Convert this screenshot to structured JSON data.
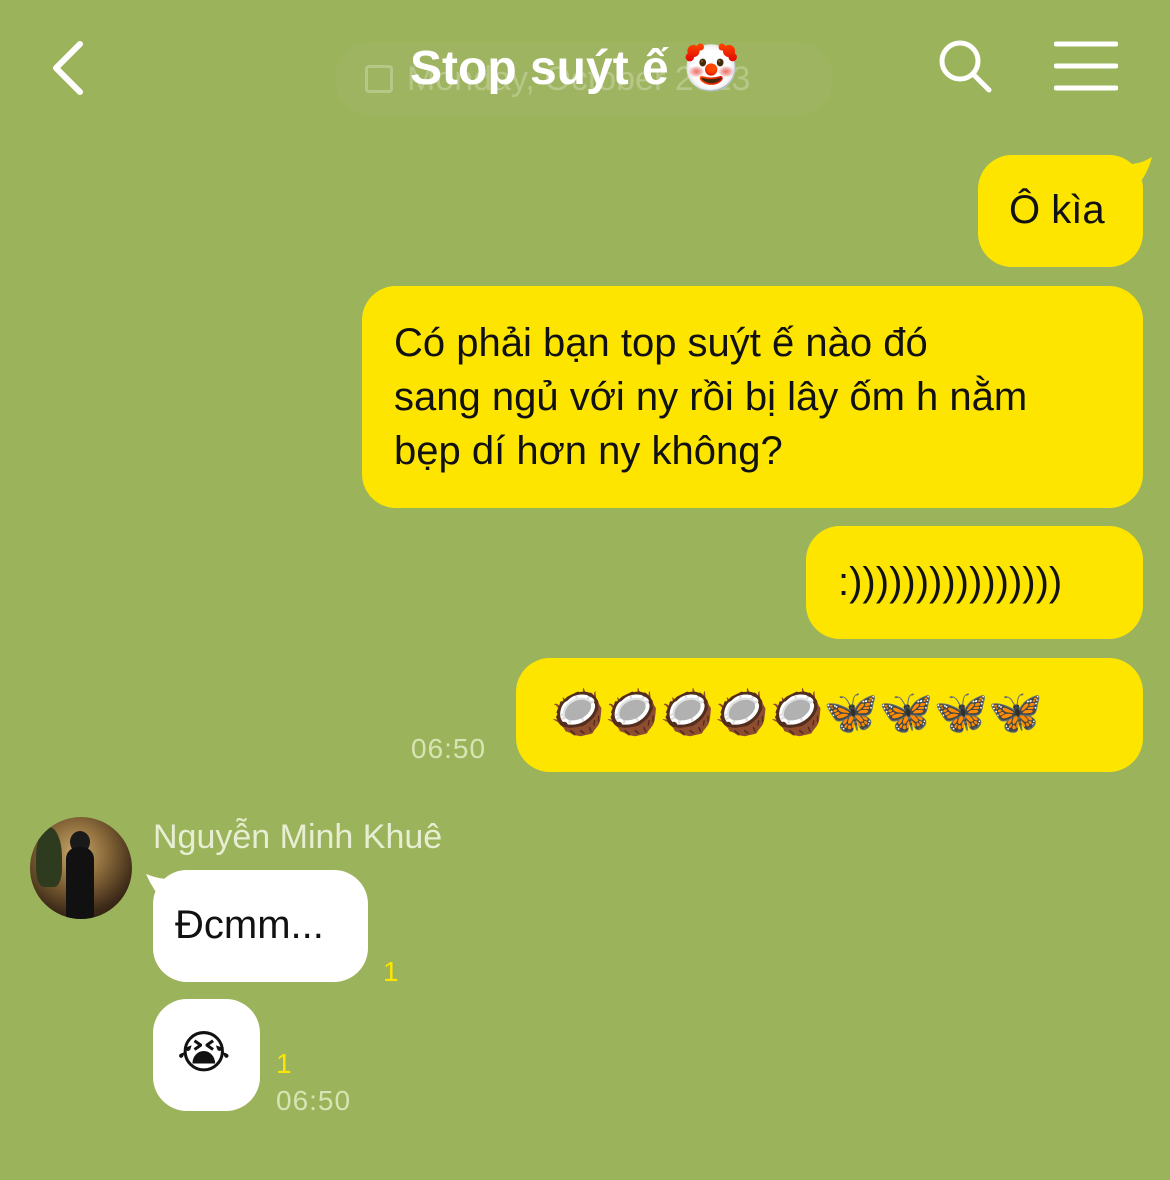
{
  "header": {
    "title": "Stop suýt ế",
    "title_emoji": "🤡",
    "date_pill": "Monday, October 2023",
    "back_icon": "chevron-left-icon",
    "search_icon": "search-icon",
    "menu_icon": "hamburger-menu-icon"
  },
  "messages": {
    "m1": "Ô kìa",
    "m2_line1": "Có phải bạn top suýt ế nào đó",
    "m2_line2": "sang ngủ với ny rồi bị lây ốm h nằm",
    "m2_line3": "bẹp dí hơn ny không?",
    "m3": ":))))))))))))))))",
    "m4": "🥥🥥🥥🥥🥥🦋🦋🦋🦋",
    "m4_time": "06:50",
    "sender_name": "Nguyễn Minh Khuê",
    "r1": "Đcmm...",
    "r1_unread": "1",
    "r2": "😭",
    "r2_unread": "1",
    "r2_time": "06:50"
  },
  "colors": {
    "background": "#9bb35a",
    "my_bubble": "#fee500",
    "their_bubble": "#ffffff",
    "unread_count": "#fee500"
  }
}
